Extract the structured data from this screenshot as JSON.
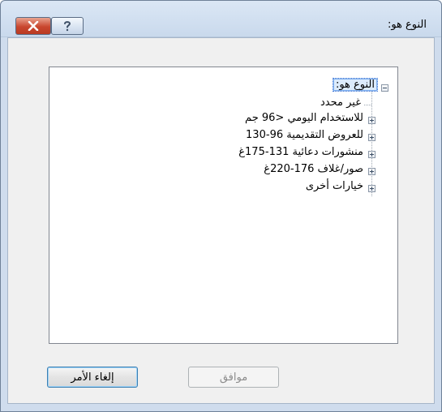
{
  "window": {
    "title": "النوع هو:",
    "close_icon": "close-icon",
    "help_icon": "help-icon"
  },
  "tree": {
    "root": "النوع هو:",
    "items": [
      "غير محدد",
      "للاستخدام اليومي <96 جم",
      "للعروض التقديمية 96-130",
      "منشورات دعائية 131-175غ",
      "صور/غلاف 176-220غ",
      "خيارات أخرى"
    ]
  },
  "buttons": {
    "ok": "موافق",
    "cancel": "إلغاء الأمر"
  }
}
